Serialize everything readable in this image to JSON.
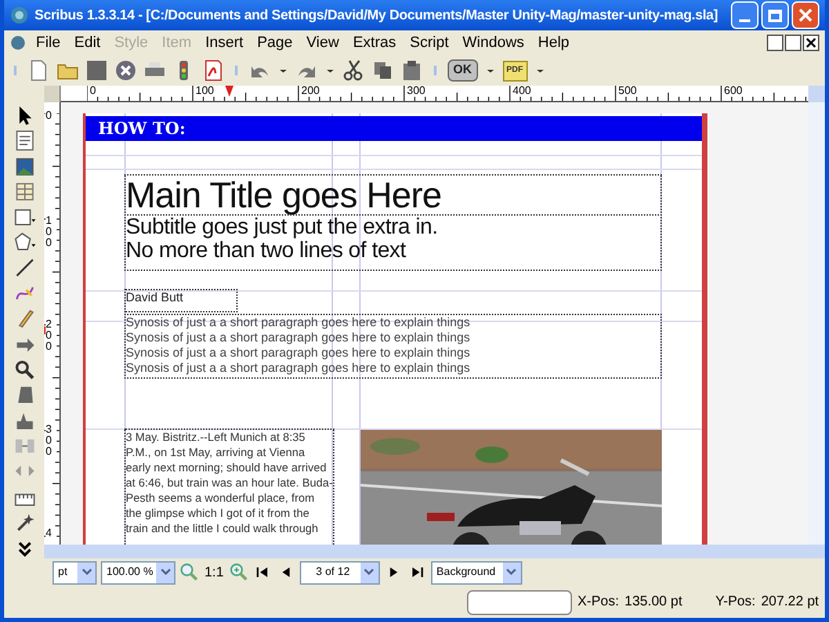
{
  "window": {
    "title": "Scribus 1.3.3.14 - [C:/Documents and Settings/David/My Documents/Master Unity-Mag/master-unity-mag.sla]"
  },
  "menu": [
    {
      "label": "File",
      "disabled": false
    },
    {
      "label": "Edit",
      "disabled": false
    },
    {
      "label": "Style",
      "disabled": true
    },
    {
      "label": "Item",
      "disabled": true
    },
    {
      "label": "Insert",
      "disabled": false
    },
    {
      "label": "Page",
      "disabled": false
    },
    {
      "label": "View",
      "disabled": false
    },
    {
      "label": "Extras",
      "disabled": false
    },
    {
      "label": "Script",
      "disabled": false
    },
    {
      "label": "Windows",
      "disabled": false
    },
    {
      "label": "Help",
      "disabled": false
    }
  ],
  "toolbar": {
    "preflight_label": "OK",
    "pdf_label": "PDF"
  },
  "rulers": {
    "horizontal": [
      "0",
      "100",
      "200",
      "300",
      "400",
      "500",
      "600"
    ],
    "vertical": [
      "0",
      "100",
      "200",
      "300",
      "4"
    ]
  },
  "document": {
    "header": "HOW TO:",
    "title": "Main Title goes Here",
    "subtitle": [
      "Subtitle goes just put the extra in.",
      "No more than two lines of text"
    ],
    "author": "David Butt",
    "synopsis": [
      "Synosis of just a a short paragraph goes here to explain things",
      "Synosis of just a a short paragraph goes here to explain things",
      "Synosis of just a a short paragraph goes here to explain things",
      "Synosis of just a a short paragraph goes here to explain things"
    ],
    "body": [
      "3 May. Bistritz.--Left Munich at 8:35",
      "P.M., on 1st May, arriving at Vienna",
      "early next morning; should have arrived",
      "at 6:46, but train was an hour late. Buda-",
      "Pesth seems a wonderful place, from",
      "the glimpse which I got of it from the",
      "train and the little I could walk through"
    ],
    "image": {
      "kind": "picture"
    }
  },
  "navigation": {
    "unit": "pt",
    "zoom": "100.00 %",
    "actual_size": "1:1",
    "page": "3 of 12",
    "layer": "Background"
  },
  "status_bar": {
    "x_label": "X-Pos:",
    "x_value": "135.00 pt",
    "y_label": "Y-Pos:",
    "y_value": "207.22 pt"
  }
}
